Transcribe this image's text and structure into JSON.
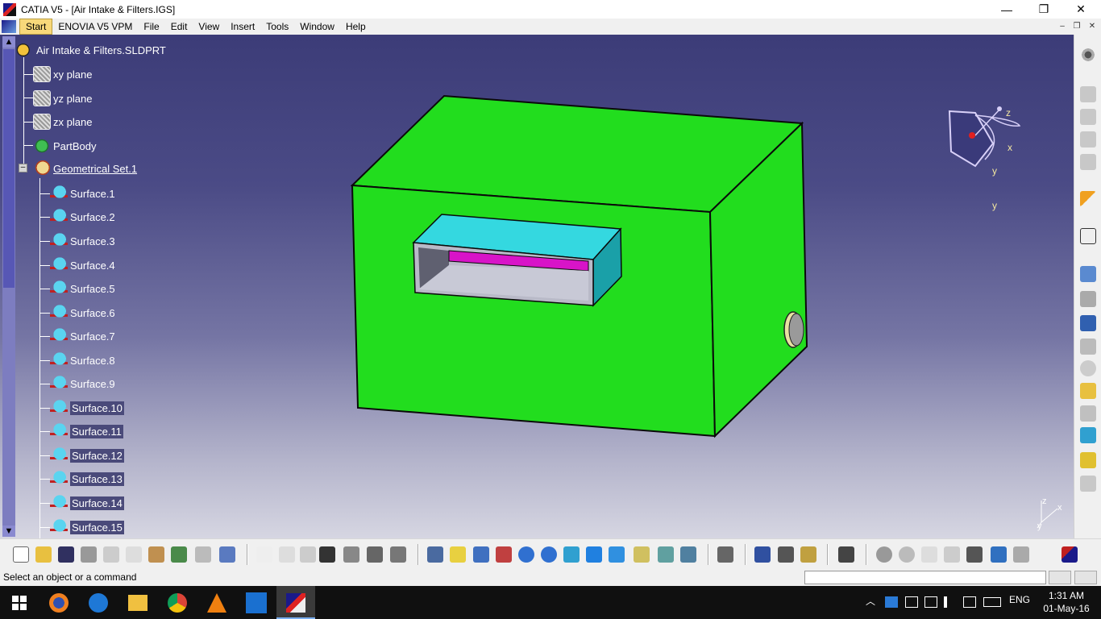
{
  "window": {
    "title": "CATIA V5 - [Air Intake & Filters.IGS]",
    "minimize_icon": "minimize-icon",
    "maximize_icon": "restore-icon",
    "close_icon": "close-icon",
    "min_glyph": "—",
    "max_glyph": "❐",
    "close_glyph": "✕"
  },
  "menu": {
    "items": [
      "Start",
      "ENOVIA V5 VPM",
      "File",
      "Edit",
      "View",
      "Insert",
      "Tools",
      "Window",
      "Help"
    ],
    "mdi_min": "–",
    "mdi_restore": "❐",
    "mdi_close": "✕"
  },
  "tree": {
    "root": "Air Intake & Filters.SLDPRT",
    "planes": [
      "xy plane",
      "yz plane",
      "zx plane"
    ],
    "part_body": "PartBody",
    "geometrical_set": "Geometrical Set.1",
    "surfaces": [
      "Surface.1",
      "Surface.2",
      "Surface.3",
      "Surface.4",
      "Surface.5",
      "Surface.6",
      "Surface.7",
      "Surface.8",
      "Surface.9",
      "Surface.10",
      "Surface.11",
      "Surface.12",
      "Surface.13",
      "Surface.14",
      "Surface.15"
    ],
    "collapse_glyph": "–",
    "scroll_up": "▲",
    "scroll_down": "▼"
  },
  "compass": {
    "x": "x",
    "y": "y",
    "z": "z"
  },
  "axis_triad": {
    "x": "x",
    "y": "y",
    "z": "z"
  },
  "status": {
    "message": "Select an object or a command"
  },
  "taskbar": {
    "time": "1:31 AM",
    "date": "01-May-16",
    "language": "ENG"
  },
  "colors": {
    "viewport_top": "#3c3c78",
    "body_green": "#22dd1e",
    "duct_cyan": "#34d8e0",
    "slot_magenta": "#d814c8"
  }
}
